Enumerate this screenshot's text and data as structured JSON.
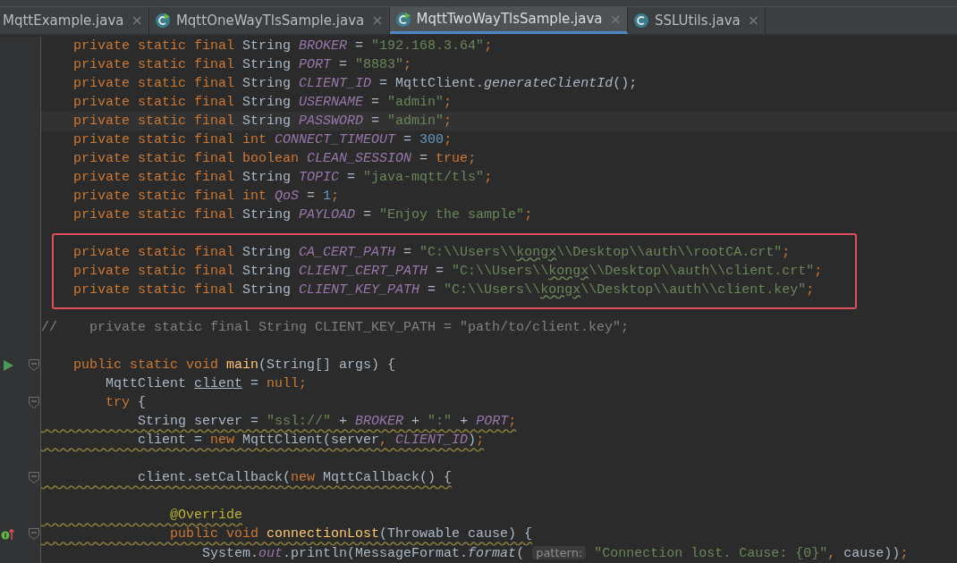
{
  "tabs": [
    {
      "label": "MqttExample.java",
      "kind": "plain",
      "selected": false,
      "close": "×"
    },
    {
      "label": "MqttOneWayTlsSample.java",
      "kind": "runnable",
      "selected": false,
      "close": "×"
    },
    {
      "label": "MqttTwoWayTlsSample.java",
      "kind": "runnable",
      "selected": true,
      "close": "×"
    },
    {
      "label": "SSLUtils.java",
      "kind": "class",
      "selected": false,
      "close": "×"
    }
  ],
  "lines": [
    {
      "tokens": [
        {
          "text": "    private static final ",
          "kind": "keyword"
        },
        {
          "text": "String ",
          "kind": "plain"
        },
        {
          "text": "BROKER",
          "kind": "constant"
        },
        {
          "text": " = ",
          "kind": "plain"
        },
        {
          "text": "\"192.168.3.64\"",
          "kind": "string"
        },
        {
          "text": ";",
          "kind": "keyword"
        }
      ]
    },
    {
      "tokens": [
        {
          "text": "    private static final ",
          "kind": "keyword"
        },
        {
          "text": "String ",
          "kind": "plain"
        },
        {
          "text": "PORT",
          "kind": "constant"
        },
        {
          "text": " = ",
          "kind": "plain"
        },
        {
          "text": "\"8883\"",
          "kind": "string"
        },
        {
          "text": ";",
          "kind": "keyword"
        }
      ]
    },
    {
      "tokens": [
        {
          "text": "    private static final ",
          "kind": "keyword"
        },
        {
          "text": "String ",
          "kind": "plain"
        },
        {
          "text": "CLIENT_ID",
          "kind": "constant"
        },
        {
          "text": " = MqttClient.",
          "kind": "plain"
        },
        {
          "text": "generateClientId",
          "kind": "static-call"
        },
        {
          "text": "();",
          "kind": "plain"
        }
      ]
    },
    {
      "tokens": [
        {
          "text": "    private static final ",
          "kind": "keyword"
        },
        {
          "text": "String ",
          "kind": "plain"
        },
        {
          "text": "USERNAME",
          "kind": "constant"
        },
        {
          "text": " = ",
          "kind": "plain"
        },
        {
          "text": "\"admin\"",
          "kind": "string"
        },
        {
          "text": ";",
          "kind": "keyword"
        }
      ]
    },
    {
      "current": true,
      "tokens": [
        {
          "text": "    private static final ",
          "kind": "keyword"
        },
        {
          "text": "String ",
          "kind": "plain"
        },
        {
          "text": "PASSWORD",
          "kind": "constant"
        },
        {
          "text": " = ",
          "kind": "plain"
        },
        {
          "text": "\"admin\"",
          "kind": "string"
        },
        {
          "text": ";",
          "kind": "keyword"
        }
      ]
    },
    {
      "tokens": [
        {
          "text": "    private static final ",
          "kind": "keyword"
        },
        {
          "text": "int ",
          "kind": "keyword"
        },
        {
          "text": "CONNECT_TIMEOUT",
          "kind": "constant"
        },
        {
          "text": " = ",
          "kind": "plain"
        },
        {
          "text": "300",
          "kind": "number"
        },
        {
          "text": ";",
          "kind": "keyword"
        }
      ]
    },
    {
      "tokens": [
        {
          "text": "    private static final ",
          "kind": "keyword"
        },
        {
          "text": "boolean ",
          "kind": "keyword"
        },
        {
          "text": "CLEAN_SESSION",
          "kind": "constant"
        },
        {
          "text": " = ",
          "kind": "plain"
        },
        {
          "text": "true",
          "kind": "keyword"
        },
        {
          "text": ";",
          "kind": "keyword"
        }
      ]
    },
    {
      "tokens": [
        {
          "text": "    private static final ",
          "kind": "keyword"
        },
        {
          "text": "String ",
          "kind": "plain"
        },
        {
          "text": "TOPIC",
          "kind": "constant"
        },
        {
          "text": " = ",
          "kind": "plain"
        },
        {
          "text": "\"java-mqtt/tls\"",
          "kind": "string"
        },
        {
          "text": ";",
          "kind": "keyword"
        }
      ]
    },
    {
      "tokens": [
        {
          "text": "    private static final ",
          "kind": "keyword"
        },
        {
          "text": "int ",
          "kind": "keyword"
        },
        {
          "text": "QoS",
          "kind": "constant"
        },
        {
          "text": " = ",
          "kind": "plain"
        },
        {
          "text": "1",
          "kind": "number"
        },
        {
          "text": ";",
          "kind": "keyword"
        }
      ]
    },
    {
      "tokens": [
        {
          "text": "    private static final ",
          "kind": "keyword"
        },
        {
          "text": "String ",
          "kind": "plain"
        },
        {
          "text": "PAYLOAD",
          "kind": "constant"
        },
        {
          "text": " = ",
          "kind": "plain"
        },
        {
          "text": "\"Enjoy the sample\"",
          "kind": "string"
        },
        {
          "text": ";",
          "kind": "keyword"
        }
      ]
    },
    {
      "kind": "blank"
    },
    {
      "boxed": true,
      "tokens": [
        {
          "text": "    private static final ",
          "kind": "keyword"
        },
        {
          "text": "String ",
          "kind": "plain"
        },
        {
          "text": "CA_CERT_PATH",
          "kind": "constant"
        },
        {
          "text": " = ",
          "kind": "plain"
        },
        {
          "text": "\"C:\\\\Users\\\\",
          "kind": "string"
        },
        {
          "text": "kongx",
          "kind": "string",
          "typo": true
        },
        {
          "text": "\\\\Desktop\\\\auth\\\\rootCA.crt\"",
          "kind": "string"
        },
        {
          "text": ";",
          "kind": "keyword"
        }
      ]
    },
    {
      "boxed": true,
      "tokens": [
        {
          "text": "    private static final ",
          "kind": "keyword"
        },
        {
          "text": "String ",
          "kind": "plain"
        },
        {
          "text": "CLIENT_CERT_PATH",
          "kind": "constant"
        },
        {
          "text": " = ",
          "kind": "plain"
        },
        {
          "text": "\"C:\\\\Users\\\\",
          "kind": "string"
        },
        {
          "text": "kongx",
          "kind": "string",
          "typo": true
        },
        {
          "text": "\\\\Desktop\\\\auth\\\\client.crt\"",
          "kind": "string"
        },
        {
          "text": ";",
          "kind": "keyword"
        }
      ]
    },
    {
      "boxed": true,
      "tokens": [
        {
          "text": "    private static final ",
          "kind": "keyword"
        },
        {
          "text": "String ",
          "kind": "plain"
        },
        {
          "text": "CLIENT_KEY_PATH",
          "kind": "constant"
        },
        {
          "text": " = ",
          "kind": "plain"
        },
        {
          "text": "\"C:\\\\Users\\\\",
          "kind": "string"
        },
        {
          "text": "kongx",
          "kind": "string",
          "typo": true
        },
        {
          "text": "\\\\Desktop\\\\auth\\\\client.key\"",
          "kind": "string"
        },
        {
          "text": ";",
          "kind": "keyword"
        }
      ]
    },
    {
      "kind": "blank"
    },
    {
      "tokens": [
        {
          "text": "//    private static final String CLIENT_KEY_PATH = \"path/to/client.key\";",
          "kind": "comment"
        }
      ]
    },
    {
      "kind": "blank"
    },
    {
      "kind": "run",
      "fold": true,
      "tokens": [
        {
          "text": "    public static void ",
          "kind": "keyword"
        },
        {
          "text": "main",
          "kind": "method"
        },
        {
          "text": "(String[] args) {",
          "kind": "plain"
        }
      ]
    },
    {
      "tokens": [
        {
          "text": "        MqttClient ",
          "kind": "plain"
        },
        {
          "text": "client",
          "kind": "plain",
          "underlined": true
        },
        {
          "text": " = ",
          "kind": "plain"
        },
        {
          "text": "null;",
          "kind": "keyword"
        }
      ]
    },
    {
      "fold": true,
      "tokens": [
        {
          "text": "        try ",
          "kind": "keyword"
        },
        {
          "text": "{",
          "kind": "plain"
        }
      ]
    },
    {
      "warning": true,
      "tokens": [
        {
          "text": "            String server = ",
          "kind": "plain"
        },
        {
          "text": "\"ssl://\"",
          "kind": "string"
        },
        {
          "text": " + ",
          "kind": "plain"
        },
        {
          "text": "BROKER",
          "kind": "constant"
        },
        {
          "text": " + ",
          "kind": "plain"
        },
        {
          "text": "\":\"",
          "kind": "string"
        },
        {
          "text": " + ",
          "kind": "plain"
        },
        {
          "text": "PORT",
          "kind": "constant"
        },
        {
          "text": ";",
          "kind": "keyword"
        }
      ]
    },
    {
      "warning": true,
      "tokens": [
        {
          "text": "            client = ",
          "kind": "plain"
        },
        {
          "text": "new ",
          "kind": "keyword"
        },
        {
          "text": "MqttClient(server",
          "kind": "plain"
        },
        {
          "text": ", ",
          "kind": "keyword"
        },
        {
          "text": "CLIENT_ID",
          "kind": "constant"
        },
        {
          "text": ")",
          "kind": "plain"
        },
        {
          "text": ";",
          "kind": "keyword"
        }
      ]
    },
    {
      "kind": "blank"
    },
    {
      "fold": true,
      "warning": true,
      "tokens": [
        {
          "text": "            client.setCallback(",
          "kind": "plain"
        },
        {
          "text": "new ",
          "kind": "keyword"
        },
        {
          "text": "MqttCallback() {",
          "kind": "plain"
        }
      ]
    },
    {
      "kind": "blank"
    },
    {
      "warning": true,
      "tokens": [
        {
          "text": "                @Override",
          "kind": "annotation"
        }
      ]
    },
    {
      "kind": "override",
      "fold": true,
      "warning": true,
      "tokens": [
        {
          "text": "                public void ",
          "kind": "keyword"
        },
        {
          "text": "connectionLost",
          "kind": "method"
        },
        {
          "text": "(Throwable cause) {",
          "kind": "plain"
        }
      ]
    },
    {
      "tokens": [
        {
          "text": "                    System.",
          "kind": "plain"
        },
        {
          "text": "out",
          "kind": "static-field"
        },
        {
          "text": ".println(MessageFormat.",
          "kind": "plain"
        },
        {
          "text": "format",
          "kind": "static-call"
        },
        {
          "text": "( ",
          "kind": "plain"
        },
        {
          "text": "pattern:",
          "kind": "hint"
        },
        {
          "text": " \"Connection lost. Cause: {0}\"",
          "kind": "string"
        },
        {
          "text": ", ",
          "kind": "keyword"
        },
        {
          "text": "cause))",
          "kind": "plain"
        },
        {
          "text": ";",
          "kind": "keyword"
        }
      ]
    }
  ]
}
